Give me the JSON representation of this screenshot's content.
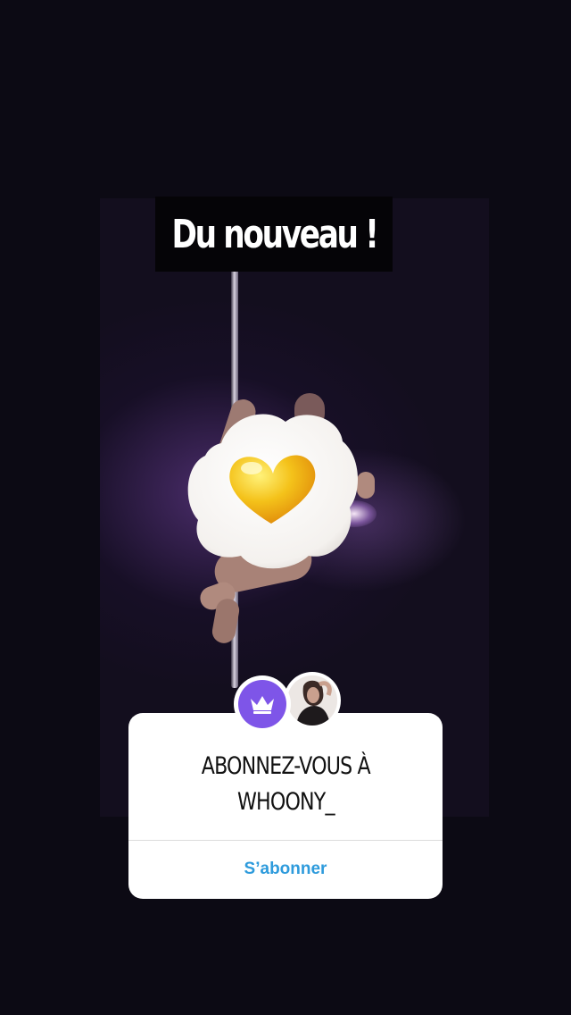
{
  "story": {
    "headline": "Du nouveau !"
  },
  "subscribe_card": {
    "title_line1": "ABONNEZ-VOUS À",
    "title_line2": "WHOONY_",
    "button_label": "S’abonner",
    "crown_icon": "crown-icon",
    "avatar_icon": "profile-avatar"
  },
  "colors": {
    "accent_purple": "#7e55e8",
    "button_blue": "#2e9bdc",
    "egg_yolk": "#f4c21a"
  }
}
